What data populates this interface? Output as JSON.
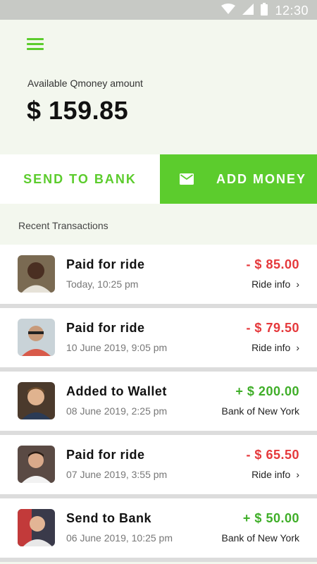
{
  "status": {
    "time": "12:30"
  },
  "header": {
    "balance_label": "Available Qmoney amount",
    "balance": "$ 159.85"
  },
  "actions": {
    "send_label": "SEND TO BANK",
    "add_label": "ADD MONEY"
  },
  "recent_label": "Recent Transactions",
  "transactions": [
    {
      "title": "Paid for ride",
      "date": "Today, 10:25 pm",
      "amount": "- $ 85.00",
      "sub": "Ride info",
      "type": "debit"
    },
    {
      "title": "Paid for ride",
      "date": "10 June 2019, 9:05 pm",
      "amount": "- $ 79.50",
      "sub": "Ride info",
      "type": "debit"
    },
    {
      "title": "Added to Wallet",
      "date": "08 June 2019, 2:25 pm",
      "amount": "+ $ 200.00",
      "sub": "Bank of New York",
      "type": "credit"
    },
    {
      "title": "Paid for ride",
      "date": "07 June 2019, 3:55 pm",
      "amount": "- $ 65.50",
      "sub": "Ride info",
      "type": "debit"
    },
    {
      "title": "Send to Bank",
      "date": "06 June 2019, 10:25 pm",
      "amount": "+ $ 50.00",
      "sub": "Bank of New York",
      "type": "credit"
    }
  ],
  "colors": {
    "accent": "#5ccc2d",
    "debit": "#e5383b",
    "credit": "#3fae28"
  }
}
